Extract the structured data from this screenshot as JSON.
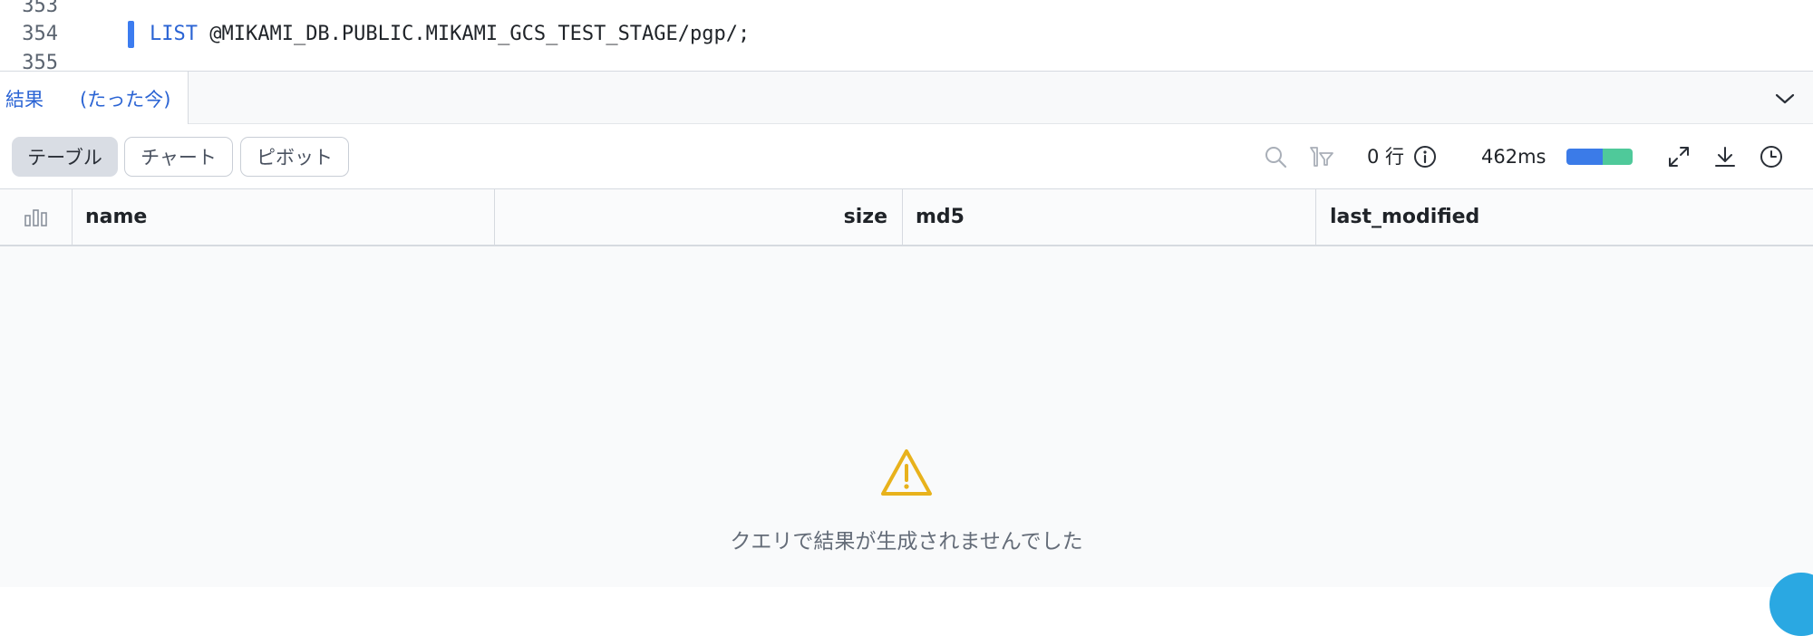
{
  "editor": {
    "lines": [
      {
        "number": "353",
        "text": ""
      },
      {
        "number": "354",
        "keyword": "LIST",
        "text": " @MIKAMI_DB.PUBLIC.MIKAMI_GCS_TEST_STAGE/pgp/;"
      },
      {
        "number": "355",
        "text": ""
      }
    ]
  },
  "results_tab": {
    "label": "結果",
    "time": "(たった今)"
  },
  "toolbar": {
    "views": [
      "テーブル",
      "チャート",
      "ピボット"
    ],
    "active_view": "テーブル",
    "row_count": "0 行",
    "duration": "462ms",
    "timing_segments": [
      {
        "label": "compile",
        "fraction": 0.55,
        "color": "#3b7be8"
      },
      {
        "label": "execute",
        "fraction": 0.45,
        "color": "#4fc99a"
      }
    ]
  },
  "table": {
    "columns": [
      "name",
      "size",
      "md5",
      "last_modified"
    ],
    "rows": []
  },
  "empty_state": {
    "message": "クエリで結果が生成されませんでした",
    "icon": "warning-icon",
    "icon_color": "#e8b21c"
  },
  "colors": {
    "accent": "#2b64d4",
    "line_marker": "#3c7cf0"
  }
}
